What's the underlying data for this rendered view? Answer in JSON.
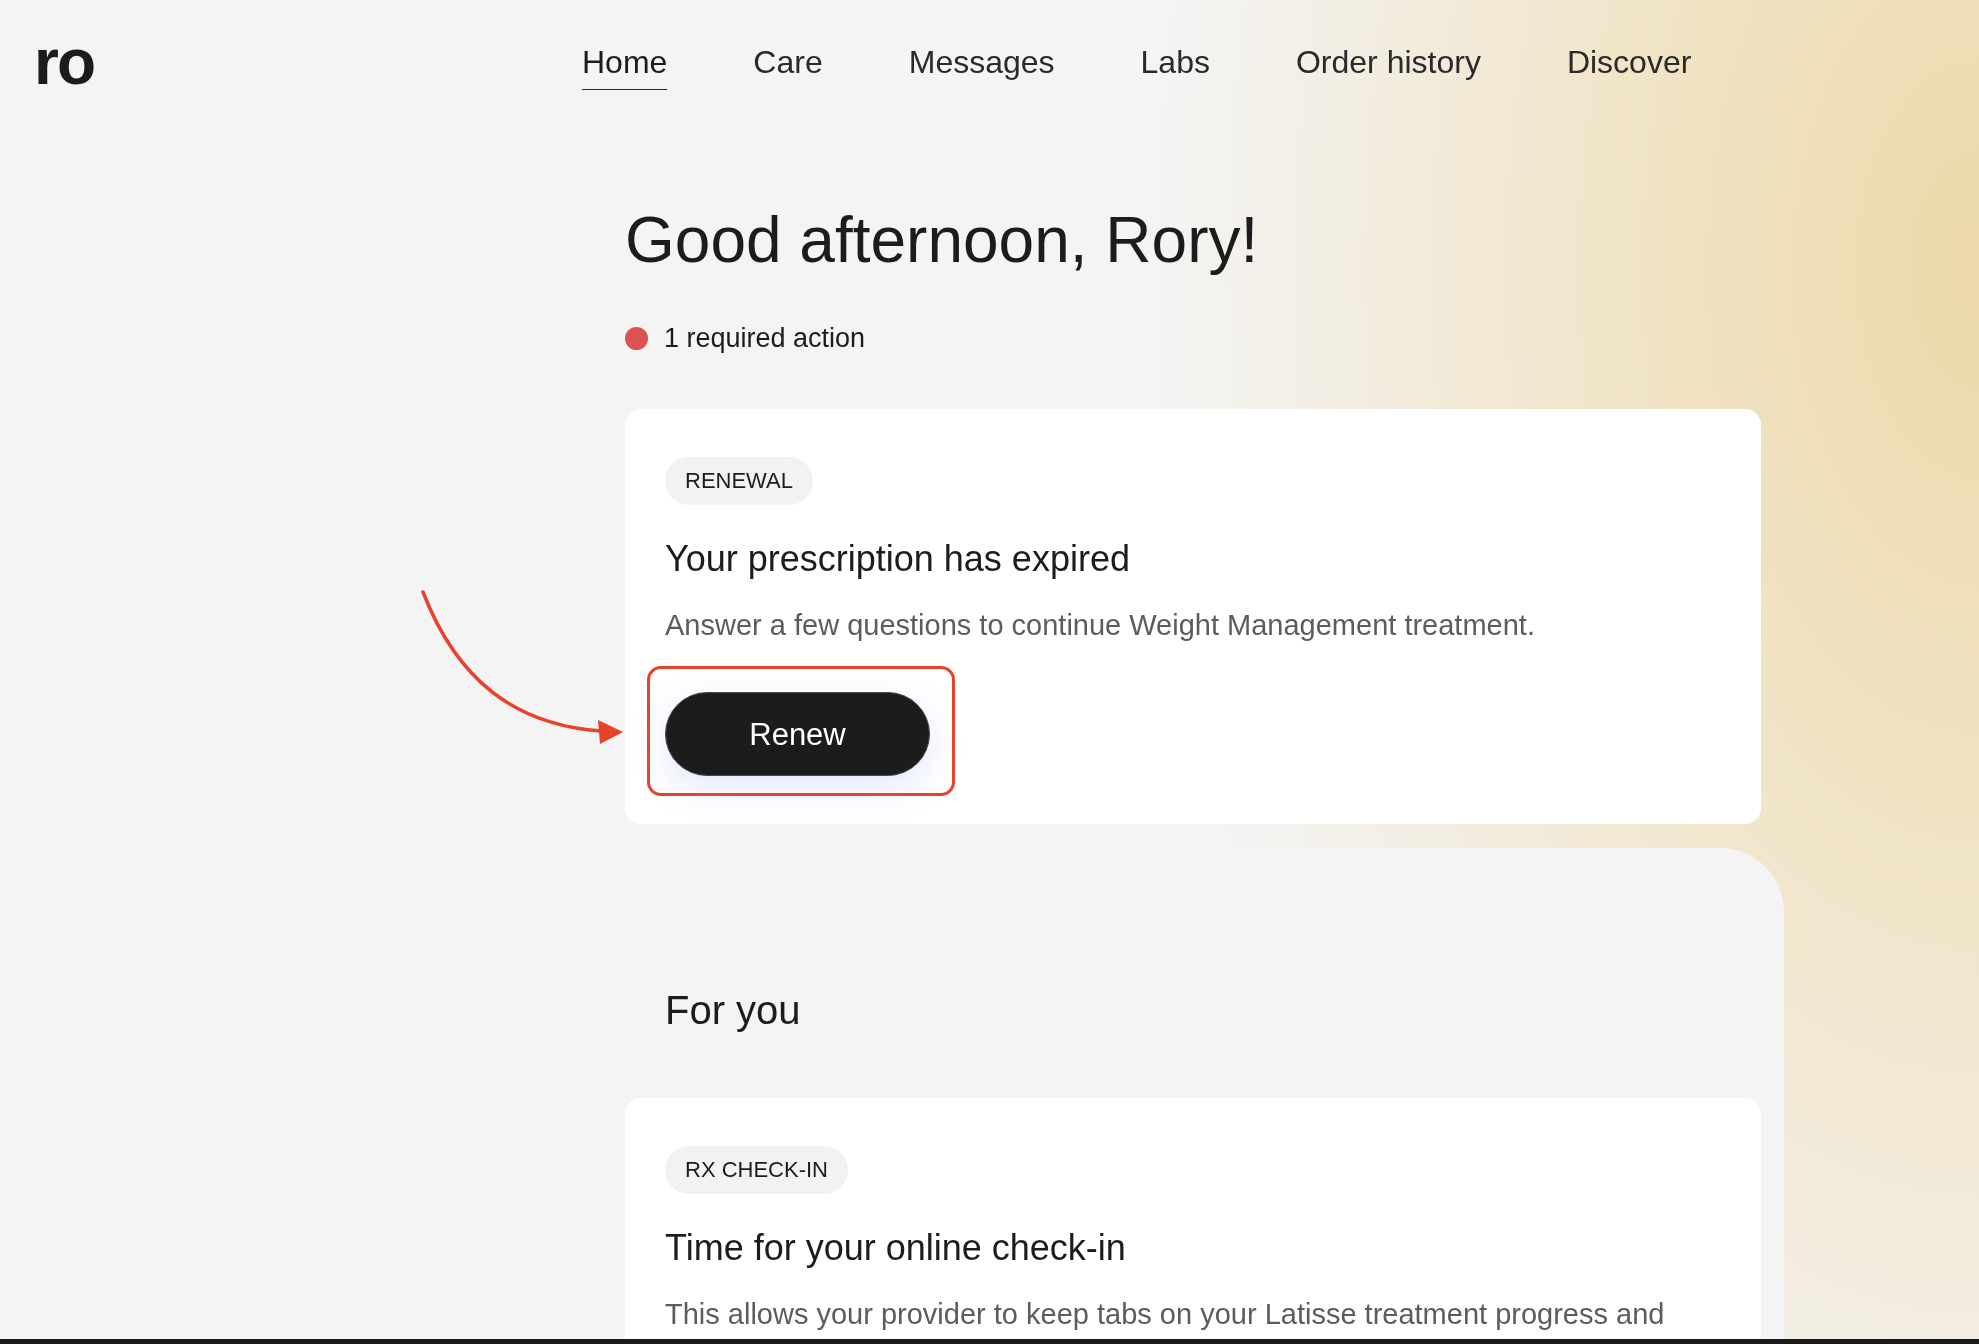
{
  "logo": {
    "text": "ro"
  },
  "nav": [
    {
      "label": "Home",
      "selected": true
    },
    {
      "label": "Care",
      "selected": false
    },
    {
      "label": "Messages",
      "selected": false
    },
    {
      "label": "Labs",
      "selected": false
    },
    {
      "label": "Order history",
      "selected": false
    },
    {
      "label": "Discover",
      "selected": false
    }
  ],
  "greeting": "Good afternoon, Rory!",
  "required_actions": {
    "label": "1 required action"
  },
  "action_card": {
    "badge": "RENEWAL",
    "title": "Your prescription has expired",
    "description": "Answer a few questions to continue Weight Management treatment.",
    "button": "Renew"
  },
  "for_you": {
    "title": "For you",
    "cards": [
      {
        "badge": "RX CHECK-IN",
        "title": "Time for your online check-in",
        "description": "This allows your provider to keep tabs on your Latisse treatment progress and"
      }
    ]
  }
}
